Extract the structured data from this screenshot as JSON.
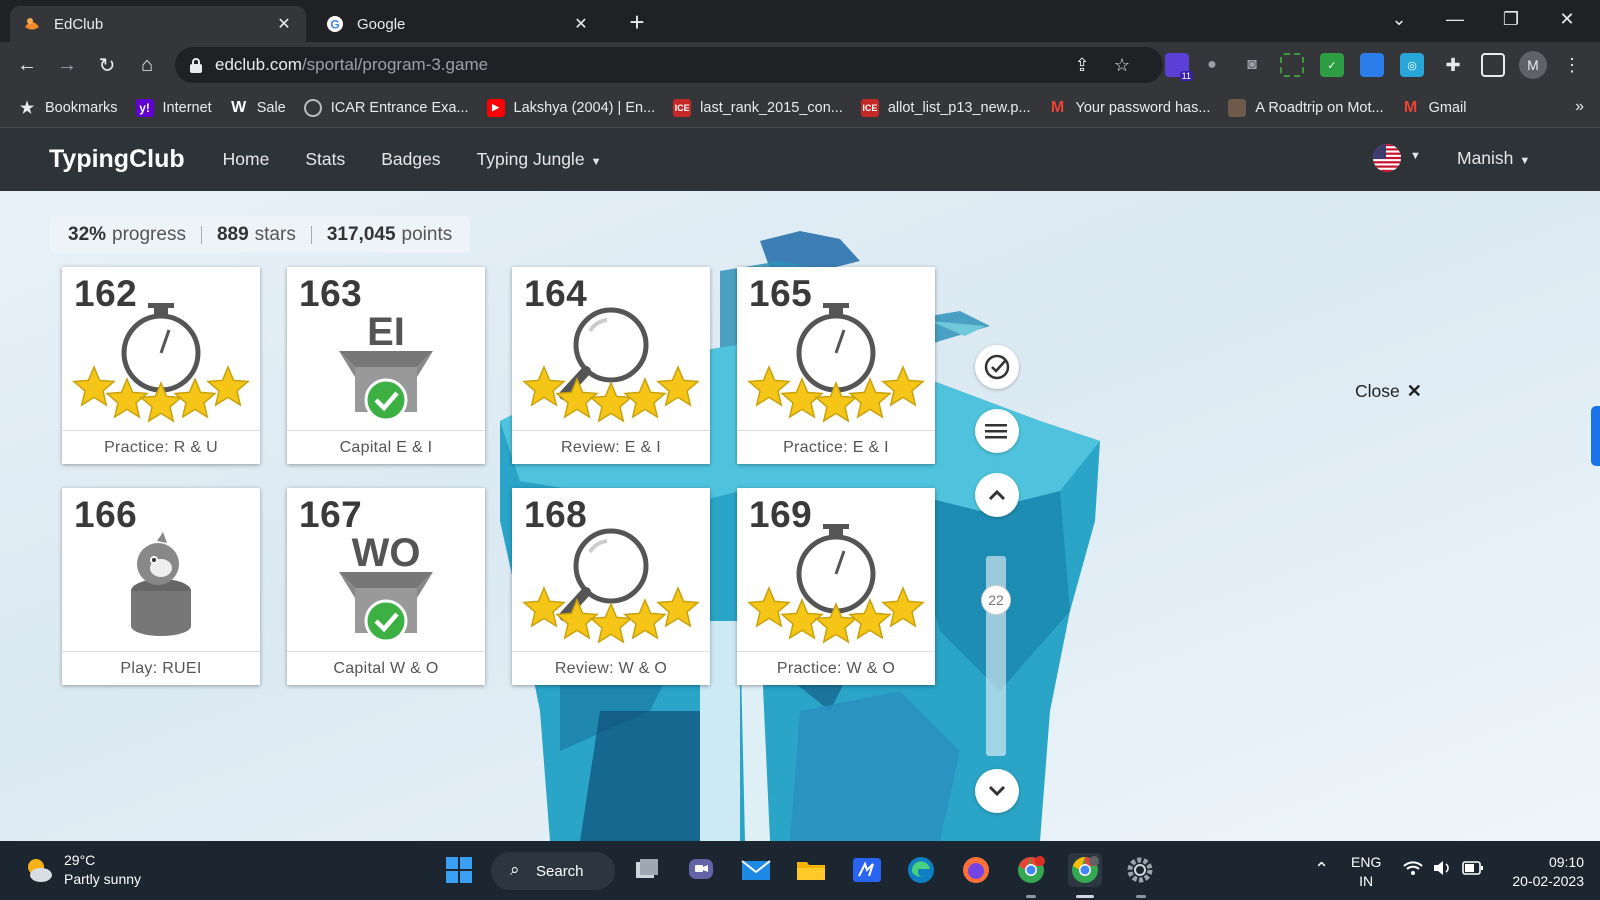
{
  "browser": {
    "tabs": [
      {
        "title": "EdClub",
        "active": true
      },
      {
        "title": "Google",
        "active": false
      }
    ],
    "url": {
      "domain": "edclub.com",
      "path": "/sportal/program-3.game"
    },
    "bookmarks": [
      {
        "label": "Bookmarks",
        "icon": "star-icon"
      },
      {
        "label": "Internet",
        "icon": "yahoo-icon"
      },
      {
        "label": "Sale",
        "icon": "w-icon"
      },
      {
        "label": "ICAR Entrance Exa...",
        "icon": "globe-icon"
      },
      {
        "label": "Lakshya (2004) | En...",
        "icon": "youtube-icon"
      },
      {
        "label": "last_rank_2015_con...",
        "icon": "pdf-icon"
      },
      {
        "label": "allot_list_p13_new.p...",
        "icon": "pdf-icon"
      },
      {
        "label": "Your password has...",
        "icon": "gmail-icon"
      },
      {
        "label": "A Roadtrip on Mot...",
        "icon": "photo-icon"
      },
      {
        "label": "Gmail",
        "icon": "gmail-icon"
      }
    ],
    "extension_badge": "11",
    "profile_initial": "M"
  },
  "site": {
    "brand": "TypingClub",
    "nav": [
      "Home",
      "Stats",
      "Badges"
    ],
    "nav_dropdown": "Typing Jungle",
    "user": "Manish"
  },
  "progress": {
    "percent": "32%",
    "percent_label": "progress",
    "stars": "889",
    "stars_label": "stars",
    "points": "317,045",
    "points_label": "points"
  },
  "lessons": [
    {
      "number": "162",
      "label": "Practice: R & U",
      "type": "stopwatch",
      "stars": 5
    },
    {
      "number": "163",
      "label": "Capital E & I",
      "type": "box",
      "letters": "EI",
      "completed": true
    },
    {
      "number": "164",
      "label": "Review: E & I",
      "type": "magnifier",
      "stars": 5
    },
    {
      "number": "165",
      "label": "Practice: E & I",
      "type": "stopwatch",
      "stars": 5
    },
    {
      "number": "166",
      "label": "Play: RUEI",
      "type": "game"
    },
    {
      "number": "167",
      "label": "Capital W & O",
      "type": "box",
      "letters": "WO",
      "completed": true
    },
    {
      "number": "168",
      "label": "Review: W & O",
      "type": "magnifier",
      "stars": 5
    },
    {
      "number": "169",
      "label": "Practice: W & O",
      "type": "stopwatch",
      "stars": 5
    }
  ],
  "side": {
    "scroll_badge": "22"
  },
  "close_label": "Close",
  "taskbar": {
    "weather_temp": "29°C",
    "weather_desc": "Partly sunny",
    "search_label": "Search",
    "lang_1": "ENG",
    "lang_2": "IN",
    "time": "09:10",
    "date": "20-02-2023"
  },
  "colors": {
    "navbar": "#2e3338",
    "star": "#f5c518",
    "check": "#3cb043",
    "accent": "#1a73e8"
  }
}
